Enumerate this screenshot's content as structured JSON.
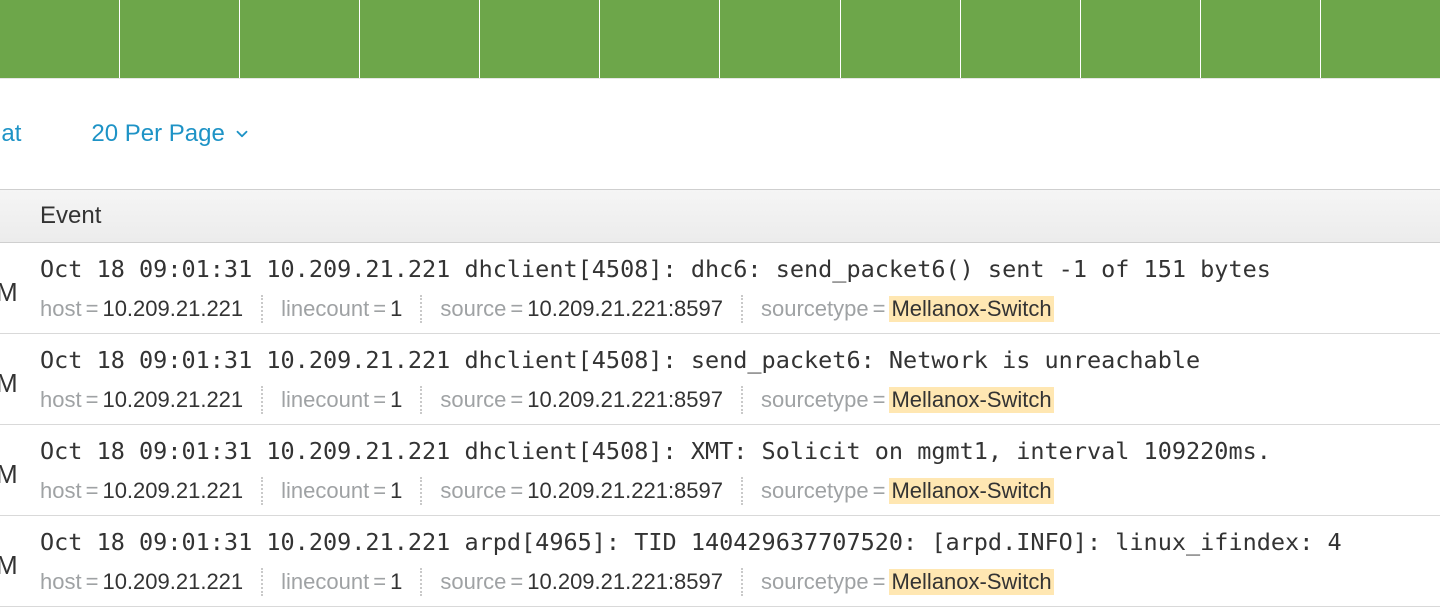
{
  "controls": {
    "format_label_visible": "nat",
    "per_page_label": "20 Per Page"
  },
  "header": {
    "event_column": "Event"
  },
  "timeline_bars": 12,
  "left_edge_glyph": "M",
  "meta_labels": {
    "host": "host",
    "linecount": "linecount",
    "source": "source",
    "sourcetype": "sourcetype"
  },
  "events": [
    {
      "raw": "Oct 18 09:01:31 10.209.21.221 dhclient[4508]: dhc6: send_packet6() sent -1 of 151 bytes",
      "host": "10.209.21.221",
      "linecount": "1",
      "source": "10.209.21.221:8597",
      "sourcetype": "Mellanox-Switch"
    },
    {
      "raw": "Oct 18 09:01:31 10.209.21.221 dhclient[4508]: send_packet6: Network is unreachable",
      "host": "10.209.21.221",
      "linecount": "1",
      "source": "10.209.21.221:8597",
      "sourcetype": "Mellanox-Switch"
    },
    {
      "raw": "Oct 18 09:01:31 10.209.21.221 dhclient[4508]: XMT: Solicit on mgmt1, interval 109220ms.",
      "host": "10.209.21.221",
      "linecount": "1",
      "source": "10.209.21.221:8597",
      "sourcetype": "Mellanox-Switch"
    },
    {
      "raw": "Oct 18 09:01:31 10.209.21.221 arpd[4965]: TID 140429637707520: [arpd.INFO]: linux_ifindex: 4",
      "host": "10.209.21.221",
      "linecount": "1",
      "source": "10.209.21.221:8597",
      "sourcetype": "Mellanox-Switch"
    }
  ]
}
